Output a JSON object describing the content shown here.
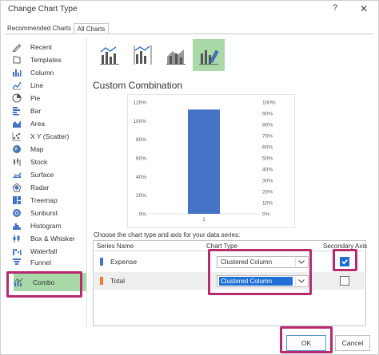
{
  "window": {
    "title": "Change Chart Type",
    "help_glyph": "?",
    "close_glyph": "✕"
  },
  "tabs": [
    {
      "label": "Recommended Charts"
    },
    {
      "label": "All Charts"
    }
  ],
  "sidebar": {
    "items": [
      {
        "label": "Recent",
        "icon": "recent-icon"
      },
      {
        "label": "Templates",
        "icon": "templates-icon"
      },
      {
        "label": "Column",
        "icon": "column-chart-icon"
      },
      {
        "label": "Line",
        "icon": "line-chart-icon"
      },
      {
        "label": "Pie",
        "icon": "pie-chart-icon"
      },
      {
        "label": "Bar",
        "icon": "bar-chart-icon"
      },
      {
        "label": "Area",
        "icon": "area-chart-icon"
      },
      {
        "label": "X Y (Scatter)",
        "icon": "scatter-chart-icon"
      },
      {
        "label": "Map",
        "icon": "map-chart-icon"
      },
      {
        "label": "Stock",
        "icon": "stock-chart-icon"
      },
      {
        "label": "Surface",
        "icon": "surface-chart-icon"
      },
      {
        "label": "Radar",
        "icon": "radar-chart-icon"
      },
      {
        "label": "Treemap",
        "icon": "treemap-chart-icon"
      },
      {
        "label": "Sunburst",
        "icon": "sunburst-chart-icon"
      },
      {
        "label": "Histogram",
        "icon": "histogram-chart-icon"
      },
      {
        "label": "Box & Whisker",
        "icon": "box-whisker-chart-icon"
      },
      {
        "label": "Waterfall",
        "icon": "waterfall-chart-icon"
      },
      {
        "label": "Funnel",
        "icon": "funnel-chart-icon"
      },
      {
        "label": "Combo",
        "icon": "combo-chart-icon",
        "selected": true
      }
    ]
  },
  "subtypes": [
    {
      "icon": "clustered-column-line-icon"
    },
    {
      "icon": "clustered-column-line-secondary-icon"
    },
    {
      "icon": "stacked-area-column-icon"
    },
    {
      "icon": "custom-combination-icon",
      "selected": true
    }
  ],
  "section_title": "Custom Combination",
  "chart_data": {
    "type": "bar",
    "categories": [
      "1"
    ],
    "series": [
      {
        "name": "Expense",
        "values": [
          1.12
        ],
        "axis": "primary"
      },
      {
        "name": "Total",
        "values": [
          null
        ],
        "axis": "secondary"
      }
    ],
    "primary_axis": {
      "ticks": [
        "0%",
        "20%",
        "40%",
        "60%",
        "80%",
        "100%",
        "120%"
      ],
      "ylim": [
        0,
        1.2
      ]
    },
    "secondary_axis": {
      "ticks": [
        "0%",
        "10%",
        "20%",
        "30%",
        "40%",
        "50%",
        "60%",
        "70%",
        "80%",
        "90%",
        "100%"
      ],
      "ylim": [
        0,
        1.0
      ]
    },
    "grid": false,
    "legend": "none"
  },
  "series_config": {
    "prompt": "Choose the chart type and axis for your data series:",
    "headers": {
      "name": "Series Name",
      "type": "Chart Type",
      "axis": "Secondary Axis"
    },
    "rows": [
      {
        "name": "Expense",
        "color": "#4472c4",
        "chart_type": "Clustered Column",
        "secondary_axis": true
      },
      {
        "name": "Total",
        "color": "#ed7d31",
        "chart_type": "Clustered Column",
        "secondary_axis": false
      }
    ]
  },
  "buttons": {
    "ok": "OK",
    "cancel": "Cancel"
  },
  "colors": {
    "bar": "#4472c4",
    "selected": "#a9d8a9",
    "highlight": "#b72a6e",
    "accent": "#1f6fd6"
  }
}
